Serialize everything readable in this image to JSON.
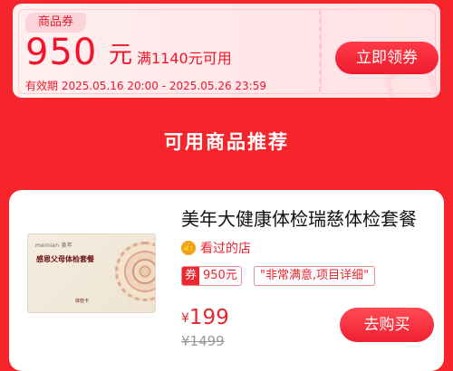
{
  "coupon": {
    "tag": "商品券",
    "amount": "950",
    "unit": "元",
    "condition": "满1140元可用",
    "validity": "有效期 2025.05.16 20:00 - 2025.05.26 23:59",
    "claim_label": "立即领券",
    "colors": {
      "accent": "#f0152a",
      "background": "#ffe6e8"
    }
  },
  "section": {
    "title": "可用商品推荐"
  },
  "product": {
    "image": {
      "brand_text": "meinian 美年",
      "card_title": "感恩父母体检套餐",
      "card_sub": "体检卡"
    },
    "title": "美年大健康体检瑞慈体检套餐",
    "visited_label": "看过的店",
    "coupon_badge_tag": "券",
    "coupon_badge_value": "950元",
    "review_badge": "\"非常满意,项目详细\"",
    "price_currency": "¥",
    "price": "199",
    "original_price": "¥1499",
    "buy_label": "去购买"
  },
  "colors": {
    "page_background": "#f5252b",
    "brand_red": "#e7252f"
  }
}
